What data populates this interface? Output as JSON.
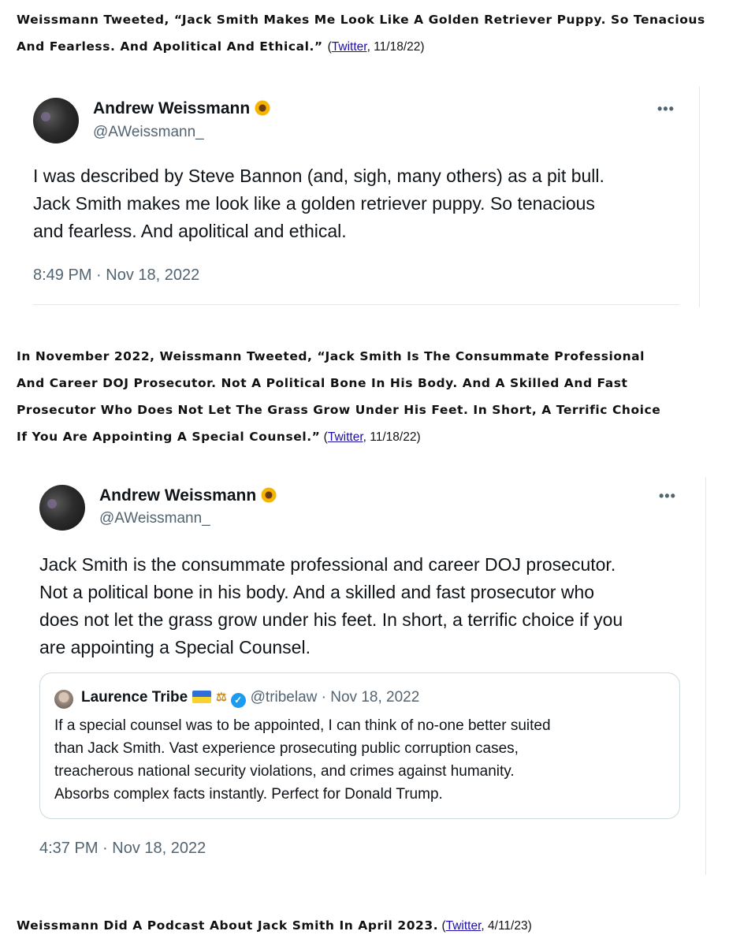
{
  "para1": {
    "text": "Weissmann Tweeted, “Jack Smith Makes Me Look Like A Golden Retriever Puppy.  So Tenacious And Fearless. And Apolitical And Ethical.”",
    "cite_open": "(",
    "link": "Twitter",
    "cite_close": ", 11/18/22)"
  },
  "tweet1": {
    "name": "Andrew Weissmann",
    "handle": "@AWeissmann_",
    "more": "•••",
    "lines": [
      "I was described by Steve Bannon (and, sigh, many others) as a pit bull.",
      "Jack Smith makes me look like a golden retriever puppy.  So tenacious",
      "and fearless. And apolitical and ethical."
    ],
    "time": "8:49 PM · Nov 18, 2022"
  },
  "para2": {
    "lines": [
      "In November 2022, Weissmann Tweeted, “Jack Smith Is The Consummate Professional",
      "And Career DOJ Prosecutor. Not A Political Bone In His Body. And A Skilled And Fast",
      "Prosecutor Who Does Not Let The Grass Grow Under His Feet. In Short, A Terrific Choice",
      "If You Are Appointing A Special Counsel.”"
    ],
    "cite_open": " (",
    "link": "Twitter",
    "cite_close": ", 11/18/22)"
  },
  "tweet2": {
    "name": "Andrew Weissmann",
    "handle": "@AWeissmann_",
    "more": "•••",
    "lines": [
      "Jack Smith is the consummate professional and career DOJ prosecutor.",
      "Not a political bone in his body. And a skilled and fast prosecutor who",
      "does not let the grass grow under his feet. In short, a terrific choice if you",
      "are appointing a Special Counsel."
    ],
    "quote": {
      "name": "Laurence Tribe",
      "meta": "@tribelaw · Nov 18, 2022",
      "scales": "⚖",
      "check": "✓",
      "lines": [
        "If a special counsel was to be appointed, I can think of no-one better suited",
        "than Jack Smith. Vast experience prosecuting public corruption cases,",
        "treacherous national security violations, and crimes against humanity.",
        "Absorbs complex facts instantly. Perfect for Donald Trump."
      ]
    },
    "time": "4:37 PM · Nov 18, 2022"
  },
  "para3": {
    "text": "Weissmann Did A Podcast About Jack Smith In April 2023.",
    "cite_open": " (",
    "link": "Twitter",
    "cite_close": ", 4/11/23)"
  }
}
